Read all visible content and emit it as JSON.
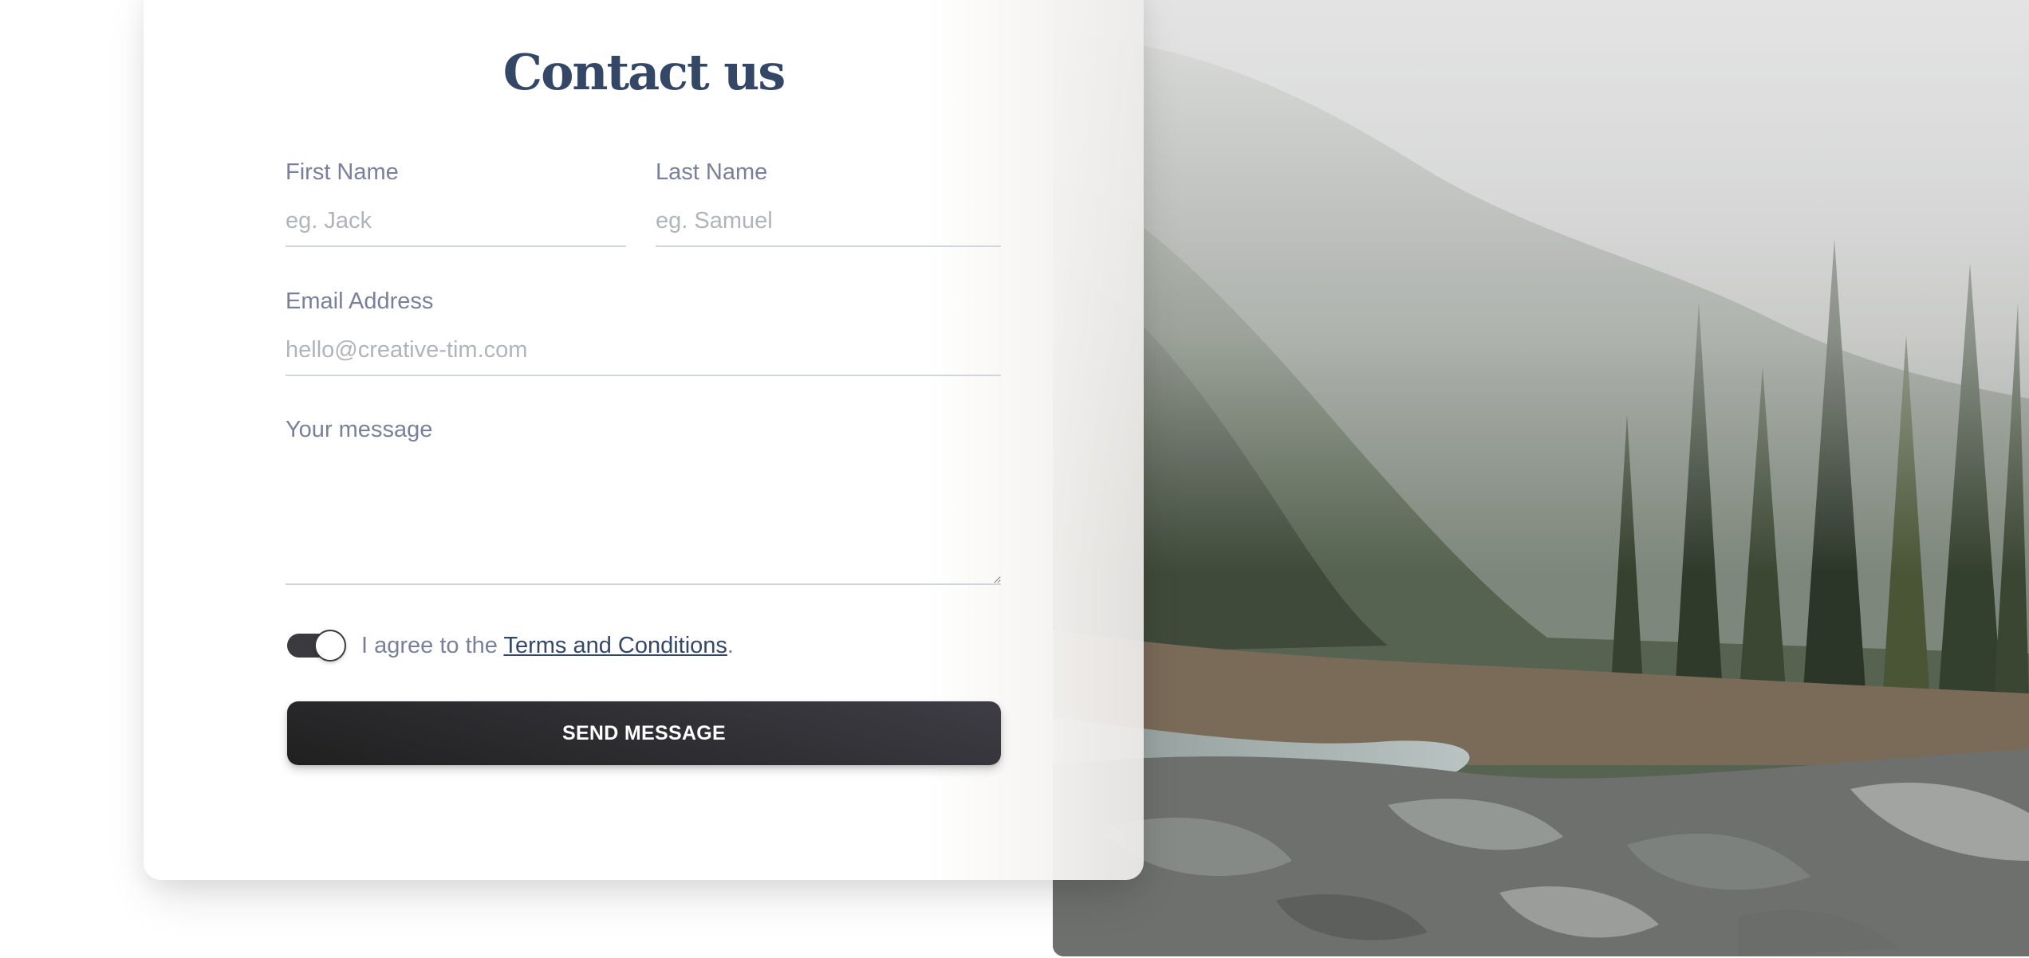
{
  "form": {
    "title": "Contact us",
    "first_name": {
      "label": "First Name",
      "placeholder": "eg. Jack",
      "value": ""
    },
    "last_name": {
      "label": "Last Name",
      "placeholder": "eg. Samuel",
      "value": ""
    },
    "email": {
      "label": "Email Address",
      "placeholder": "hello@creative-tim.com",
      "value": ""
    },
    "message": {
      "label": "Your message",
      "value": ""
    },
    "agree": {
      "checked": true,
      "prefix": "I agree to the ",
      "link_text": "Terms and Conditions",
      "suffix": "."
    },
    "submit_label": "SEND MESSAGE"
  },
  "image": {
    "subject": "misty forest river landscape"
  },
  "colors": {
    "title": "#344767",
    "label": "#7b809a",
    "button": "#202020",
    "toggle_on": "#3a3a3f"
  }
}
